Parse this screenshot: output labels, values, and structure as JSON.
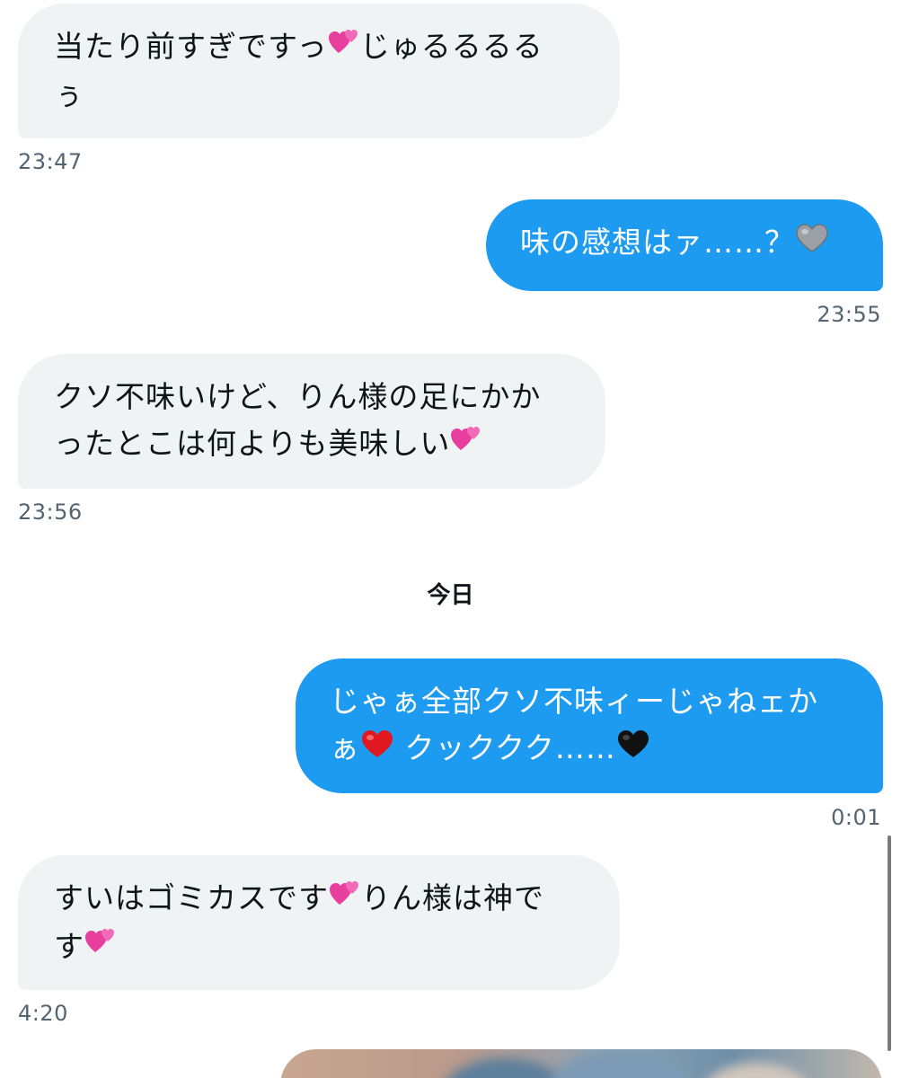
{
  "day_separator": "今日",
  "colors": {
    "incoming_bubble": "#eff3f4",
    "outgoing_bubble": "#1d9bf0",
    "timestamp": "#536471"
  },
  "messages": [
    {
      "direction": "incoming",
      "lines": [
        [
          "当たり前すぎですっ",
          "pink-hearts-emoji",
          "じゅるるるる"
        ],
        [
          "ぅ"
        ]
      ],
      "time": "23:47"
    },
    {
      "direction": "outgoing",
      "lines": [
        [
          "味の感想はァ……？",
          "grey-heart-emoji"
        ]
      ],
      "time": "23:55"
    },
    {
      "direction": "incoming",
      "lines": [
        [
          "クソ不味いけど、りん様の足にかか"
        ],
        [
          "ったとこは何よりも美味しい",
          "pink-hearts-emoji"
        ]
      ],
      "time": "23:56"
    },
    {
      "direction": "outgoing",
      "lines": [
        [
          "じゃぁ全部クソ不味ィーじゃねェか"
        ],
        [
          "ぁ",
          "red-heart-emoji",
          " クッククク……",
          "black-heart-emoji"
        ]
      ],
      "time": "0:01"
    },
    {
      "direction": "incoming",
      "lines": [
        [
          "すいはゴミカスです",
          "pink-hearts-emoji",
          "りん様は神で"
        ],
        [
          "す",
          "pink-hearts-emoji"
        ]
      ],
      "time": "4:20"
    }
  ],
  "m1": {
    "l1": "当たり前すぎですっ",
    "l1b": "じゅるるるる",
    "l2": "ぅ",
    "time": "23:47"
  },
  "m2": {
    "l1": "味の感想はァ……？",
    "time": "23:55"
  },
  "m3": {
    "l1": "クソ不味いけど、りん様の足にかか",
    "l2": "ったとこは何よりも美味しい",
    "time": "23:56"
  },
  "m4": {
    "l1": "じゃぁ全部クソ不味ィーじゃねェか",
    "l2a": "ぁ",
    "l2b": " クッククク……",
    "time": "0:01"
  },
  "m5": {
    "l1": "すいはゴミカスです",
    "l1b": "りん様は神で",
    "l2": "す",
    "time": "4:20"
  }
}
